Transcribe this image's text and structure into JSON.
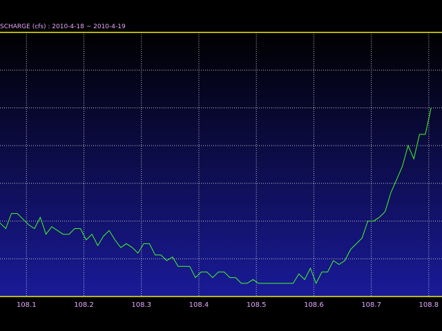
{
  "title": "SCHARGE (cfs) : 2010-4-18 ~ 2010-4-19",
  "colors": {
    "background_top": "#000000",
    "background_bottom": "#1a1a99",
    "frame": "#f0f010",
    "grid": "#c8c8c8",
    "series_line": "#44ff22",
    "text": "#e8a8ff"
  },
  "chart_data": {
    "type": "line",
    "title": "SCHARGE (cfs) : 2010-4-18 ~ 2010-4-19",
    "xlabel": "",
    "ylabel": "",
    "grid": true,
    "x_tick_labels": [
      "108.1",
      "108.2",
      "108.3",
      "108.4",
      "108.5",
      "108.6",
      "108.7",
      "108.8"
    ],
    "xlim": [
      108.054,
      108.823
    ],
    "ylim": [
      0,
      7
    ],
    "y_tick_labels": [],
    "series": [
      {
        "values": [
          [
            108.054,
            1.95
          ],
          [
            108.064,
            1.8
          ],
          [
            108.074,
            2.2
          ],
          [
            108.084,
            2.2
          ],
          [
            108.094,
            2.05
          ],
          [
            108.104,
            1.9
          ],
          [
            108.114,
            1.8
          ],
          [
            108.124,
            2.1
          ],
          [
            108.134,
            1.65
          ],
          [
            108.144,
            1.85
          ],
          [
            108.154,
            1.75
          ],
          [
            108.164,
            1.65
          ],
          [
            108.174,
            1.65
          ],
          [
            108.184,
            1.8
          ],
          [
            108.194,
            1.8
          ],
          [
            108.204,
            1.5
          ],
          [
            108.214,
            1.65
          ],
          [
            108.224,
            1.35
          ],
          [
            108.234,
            1.6
          ],
          [
            108.244,
            1.75
          ],
          [
            108.254,
            1.5
          ],
          [
            108.264,
            1.3
          ],
          [
            108.274,
            1.4
          ],
          [
            108.284,
            1.3
          ],
          [
            108.294,
            1.15
          ],
          [
            108.304,
            1.4
          ],
          [
            108.314,
            1.4
          ],
          [
            108.324,
            1.1
          ],
          [
            108.334,
            1.1
          ],
          [
            108.344,
            0.95
          ],
          [
            108.354,
            1.05
          ],
          [
            108.364,
            0.8
          ],
          [
            108.374,
            0.8
          ],
          [
            108.384,
            0.8
          ],
          [
            108.394,
            0.5
          ],
          [
            108.404,
            0.65
          ],
          [
            108.414,
            0.65
          ],
          [
            108.424,
            0.5
          ],
          [
            108.434,
            0.65
          ],
          [
            108.444,
            0.65
          ],
          [
            108.454,
            0.5
          ],
          [
            108.464,
            0.5
          ],
          [
            108.474,
            0.35
          ],
          [
            108.484,
            0.35
          ],
          [
            108.494,
            0.45
          ],
          [
            108.504,
            0.35
          ],
          [
            108.514,
            0.35
          ],
          [
            108.524,
            0.35
          ],
          [
            108.534,
            0.35
          ],
          [
            108.544,
            0.35
          ],
          [
            108.554,
            0.35
          ],
          [
            108.564,
            0.35
          ],
          [
            108.574,
            0.6
          ],
          [
            108.584,
            0.45
          ],
          [
            108.594,
            0.75
          ],
          [
            108.604,
            0.35
          ],
          [
            108.614,
            0.65
          ],
          [
            108.624,
            0.65
          ],
          [
            108.634,
            0.95
          ],
          [
            108.644,
            0.85
          ],
          [
            108.654,
            0.95
          ],
          [
            108.664,
            1.25
          ],
          [
            108.674,
            1.4
          ],
          [
            108.684,
            1.55
          ],
          [
            108.694,
            2.0
          ],
          [
            108.704,
            2.0
          ],
          [
            108.714,
            2.1
          ],
          [
            108.724,
            2.25
          ],
          [
            108.734,
            2.75
          ],
          [
            108.744,
            3.1
          ],
          [
            108.754,
            3.45
          ],
          [
            108.764,
            4.0
          ],
          [
            108.774,
            3.65
          ],
          [
            108.784,
            4.3
          ],
          [
            108.794,
            4.3
          ],
          [
            108.804,
            5.0
          ]
        ]
      }
    ]
  }
}
